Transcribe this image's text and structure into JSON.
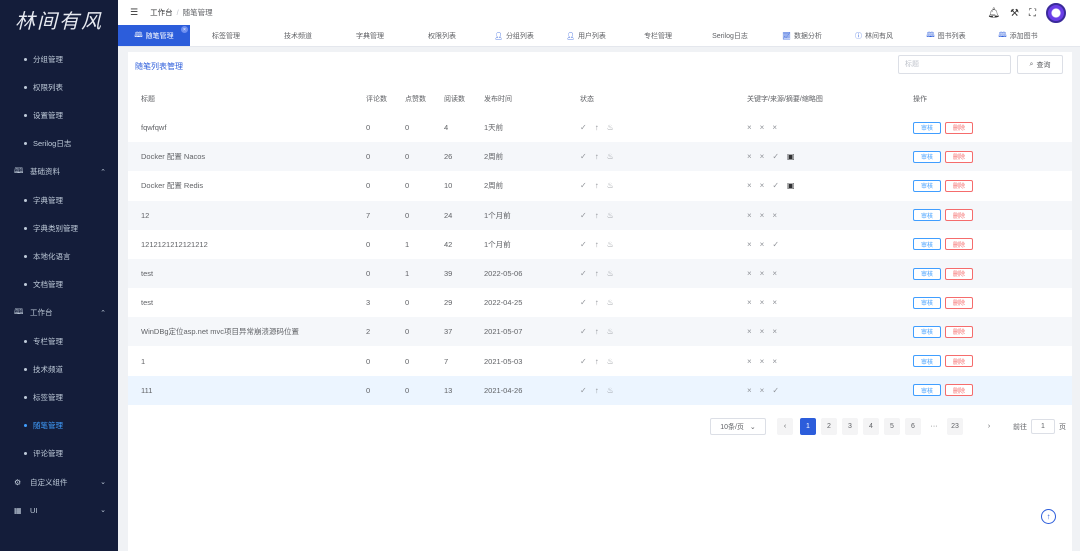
{
  "logo": "林间有风",
  "sidebar": {
    "items": [
      {
        "label": "分组管理",
        "type": "sub"
      },
      {
        "label": "权限列表",
        "type": "sub"
      },
      {
        "label": "设置管理",
        "type": "sub"
      },
      {
        "label": "Serilog日志",
        "type": "sub"
      },
      {
        "label": "基础资料",
        "type": "group",
        "icon": "book-icon",
        "arrow": "^"
      },
      {
        "label": "字典管理",
        "type": "sub"
      },
      {
        "label": "字典类别管理",
        "type": "sub"
      },
      {
        "label": "本地化语言",
        "type": "sub"
      },
      {
        "label": "文档管理",
        "type": "sub"
      },
      {
        "label": "工作台",
        "type": "group",
        "icon": "book-icon",
        "arrow": "^"
      },
      {
        "label": "专栏管理",
        "type": "sub"
      },
      {
        "label": "技术频道",
        "type": "sub"
      },
      {
        "label": "标签管理",
        "type": "sub"
      },
      {
        "label": "随笔管理",
        "type": "sub",
        "active": true
      },
      {
        "label": "评论管理",
        "type": "sub"
      },
      {
        "label": "自定义组件",
        "type": "group",
        "icon": "gear-icon",
        "arrow": "v"
      },
      {
        "label": "UI",
        "type": "group",
        "icon": "grid-icon",
        "arrow": "v"
      }
    ]
  },
  "header": {
    "menu_icon": "☰",
    "breadcrumb": [
      "工作台",
      "随笔管理"
    ]
  },
  "tabs": [
    {
      "label": "随笔管理",
      "icon": "book-icon",
      "active": true
    },
    {
      "label": "标签管理"
    },
    {
      "label": "技术频道"
    },
    {
      "label": "字典管理"
    },
    {
      "label": "权限列表"
    },
    {
      "label": "分组列表",
      "icon": "user-icon"
    },
    {
      "label": "用户列表",
      "icon": "user-icon"
    },
    {
      "label": "专栏管理"
    },
    {
      "label": "Serilog日志"
    },
    {
      "label": "数据分析",
      "icon": "chart-icon"
    },
    {
      "label": "林间有风",
      "icon": "info-icon"
    },
    {
      "label": "图书列表",
      "icon": "book-icon"
    },
    {
      "label": "添加图书",
      "icon": "book-icon"
    },
    {
      "label": "B",
      "icon": "edit-icon"
    }
  ],
  "main": {
    "title": "随笔列表管理",
    "search_placeholder": "标题",
    "search_button": "查询",
    "columns": {
      "title": "标题",
      "comments": "评论数",
      "likes": "点赞数",
      "reads": "阅读数",
      "time": "发布时间",
      "status": "状态",
      "keywords": "关键字/来源/摘要/缩略图",
      "ops": "操作"
    },
    "rows": [
      {
        "title": "fqwfqwf",
        "comments": "0",
        "likes": "0",
        "reads": "4",
        "time": "1天前",
        "kw": [
          "×",
          "×",
          "×"
        ]
      },
      {
        "title": "Docker 配置 Nacos",
        "comments": "0",
        "likes": "0",
        "reads": "26",
        "time": "2周前",
        "kw": [
          "×",
          "×",
          "✓",
          "▣"
        ]
      },
      {
        "title": "Docker 配置 Redis",
        "comments": "0",
        "likes": "0",
        "reads": "10",
        "time": "2周前",
        "kw": [
          "×",
          "×",
          "✓",
          "▣"
        ]
      },
      {
        "title": "12",
        "comments": "7",
        "likes": "0",
        "reads": "24",
        "time": "1个月前",
        "kw": [
          "×",
          "×",
          "×"
        ]
      },
      {
        "title": "1212121212121212",
        "comments": "0",
        "likes": "1",
        "reads": "42",
        "time": "1个月前",
        "kw": [
          "×",
          "×",
          "✓"
        ]
      },
      {
        "title": "test",
        "comments": "0",
        "likes": "1",
        "reads": "39",
        "time": "2022-05-06",
        "kw": [
          "×",
          "×",
          "×"
        ]
      },
      {
        "title": "test",
        "comments": "3",
        "likes": "0",
        "reads": "29",
        "time": "2022-04-25",
        "kw": [
          "×",
          "×",
          "×"
        ]
      },
      {
        "title": "WinDBg定位asp.net mvc项目异常崩溃源码位置",
        "comments": "2",
        "likes": "0",
        "reads": "37",
        "time": "2021-05-07",
        "kw": [
          "×",
          "×",
          "×"
        ]
      },
      {
        "title": "1",
        "comments": "0",
        "likes": "0",
        "reads": "7",
        "time": "2021-05-03",
        "kw": [
          "×",
          "×",
          "×"
        ]
      },
      {
        "title": "111",
        "comments": "0",
        "likes": "0",
        "reads": "13",
        "time": "2021-04-26",
        "kw": [
          "×",
          "×",
          "✓"
        ]
      }
    ],
    "status_icons": [
      "✓",
      "↑",
      "♨"
    ],
    "audit_label": "审核",
    "delete_label": "删除"
  },
  "pagination": {
    "page_size": "10条/页",
    "pages": [
      "1",
      "2",
      "3",
      "4",
      "5",
      "6",
      "···",
      "23"
    ],
    "current": "1",
    "goto_label": "前往",
    "goto_value": "1",
    "page_unit": "页"
  },
  "colors": {
    "accent": "#2c5ddb",
    "sidebar": "#141d3a",
    "danger": "#f56c6c"
  }
}
